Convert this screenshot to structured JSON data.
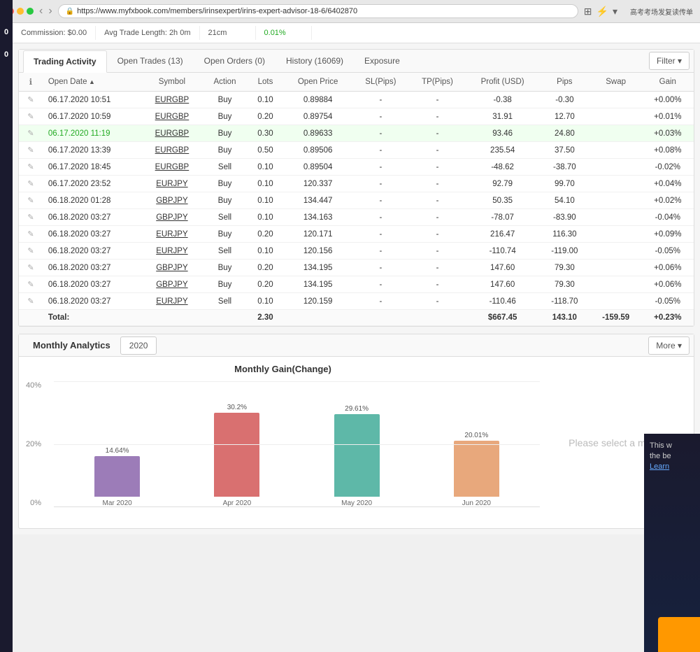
{
  "browser": {
    "url": "https://www.myfxbook.com/members/irinsexpert/irins-expert-advisor-18-6/6402870",
    "lock_symbol": "🔒"
  },
  "top_partial": {
    "cells": [
      {
        "label": "Commission:",
        "value": "$0.00"
      },
      {
        "label": "Avg Trade Length:",
        "value": "2h 0m"
      },
      {
        "label": "",
        "value": "21cm"
      },
      {
        "label": "",
        "value": "0.01%"
      }
    ]
  },
  "trading_activity": {
    "title": "Trading Activity",
    "tabs": [
      {
        "label": "Trading Activity",
        "active": true
      },
      {
        "label": "Open Trades (13)",
        "active": false
      },
      {
        "label": "Open Orders (0)",
        "active": false
      },
      {
        "label": "History (16069)",
        "active": false
      },
      {
        "label": "Exposure",
        "active": false
      }
    ],
    "filter_label": "Filter",
    "columns": [
      "",
      "Open Date",
      "Symbol",
      "Action",
      "Lots",
      "Open Price",
      "SL(Pips)",
      "TP(Pips)",
      "Profit (USD)",
      "Pips",
      "Swap",
      "Gain"
    ],
    "rows": [
      {
        "date": "06.17.2020 10:51",
        "symbol": "EURGBP",
        "action": "Buy",
        "lots": "0.10",
        "open_price": "0.89884",
        "sl": "-",
        "tp": "-",
        "profit": "-0.38",
        "pips": "-0.30",
        "swap": "",
        "gain": "+0.00%",
        "profit_class": "val-negative",
        "pips_class": "val-negative",
        "gain_class": "val-positive",
        "highlighted": false
      },
      {
        "date": "06.17.2020 10:59",
        "symbol": "EURGBP",
        "action": "Buy",
        "lots": "0.20",
        "open_price": "0.89754",
        "sl": "-",
        "tp": "-",
        "profit": "31.91",
        "pips": "12.70",
        "swap": "",
        "gain": "+0.01%",
        "profit_class": "val-positive",
        "pips_class": "val-positive",
        "gain_class": "val-positive",
        "highlighted": false
      },
      {
        "date": "06.17.2020 11:19",
        "symbol": "EURGBP",
        "action": "Buy",
        "lots": "0.30",
        "open_price": "0.89633",
        "sl": "-",
        "tp": "-",
        "profit": "93.46",
        "pips": "24.80",
        "swap": "",
        "gain": "+0.03%",
        "profit_class": "val-positive",
        "pips_class": "val-positive",
        "gain_class": "val-positive",
        "highlighted": true
      },
      {
        "date": "06.17.2020 13:39",
        "symbol": "EURGBP",
        "action": "Buy",
        "lots": "0.50",
        "open_price": "0.89506",
        "sl": "-",
        "tp": "-",
        "profit": "235.54",
        "pips": "37.50",
        "swap": "",
        "gain": "+0.08%",
        "profit_class": "val-positive",
        "pips_class": "val-positive",
        "gain_class": "val-positive",
        "highlighted": false
      },
      {
        "date": "06.17.2020 18:45",
        "symbol": "EURGBP",
        "action": "Sell",
        "lots": "0.10",
        "open_price": "0.89504",
        "sl": "-",
        "tp": "-",
        "profit": "-48.62",
        "pips": "-38.70",
        "swap": "",
        "gain": "-0.02%",
        "profit_class": "val-negative",
        "pips_class": "val-negative",
        "gain_class": "val-negative",
        "highlighted": false
      },
      {
        "date": "06.17.2020 23:52",
        "symbol": "EURJPY",
        "action": "Buy",
        "lots": "0.10",
        "open_price": "120.337",
        "sl": "-",
        "tp": "-",
        "profit": "92.79",
        "pips": "99.70",
        "swap": "",
        "gain": "+0.04%",
        "profit_class": "val-positive",
        "pips_class": "val-positive",
        "gain_class": "val-positive",
        "highlighted": false
      },
      {
        "date": "06.18.2020 01:28",
        "symbol": "GBPJPY",
        "action": "Buy",
        "lots": "0.10",
        "open_price": "134.447",
        "sl": "-",
        "tp": "-",
        "profit": "50.35",
        "pips": "54.10",
        "swap": "",
        "gain": "+0.02%",
        "profit_class": "val-positive",
        "pips_class": "val-positive",
        "gain_class": "val-positive",
        "highlighted": false
      },
      {
        "date": "06.18.2020 03:27",
        "symbol": "GBPJPY",
        "action": "Sell",
        "lots": "0.10",
        "open_price": "134.163",
        "sl": "-",
        "tp": "-",
        "profit": "-78.07",
        "pips": "-83.90",
        "swap": "",
        "gain": "-0.04%",
        "profit_class": "val-negative",
        "pips_class": "val-negative",
        "gain_class": "val-negative",
        "highlighted": false
      },
      {
        "date": "06.18.2020 03:27",
        "symbol": "EURJPY",
        "action": "Buy",
        "lots": "0.20",
        "open_price": "120.171",
        "sl": "-",
        "tp": "-",
        "profit": "216.47",
        "pips": "116.30",
        "swap": "",
        "gain": "+0.09%",
        "profit_class": "val-positive",
        "pips_class": "val-positive",
        "gain_class": "val-positive",
        "highlighted": false
      },
      {
        "date": "06.18.2020 03:27",
        "symbol": "EURJPY",
        "action": "Sell",
        "lots": "0.10",
        "open_price": "120.156",
        "sl": "-",
        "tp": "-",
        "profit": "-110.74",
        "pips": "-119.00",
        "swap": "",
        "gain": "-0.05%",
        "profit_class": "val-negative",
        "pips_class": "val-negative",
        "gain_class": "val-negative",
        "highlighted": false
      },
      {
        "date": "06.18.2020 03:27",
        "symbol": "GBPJPY",
        "action": "Buy",
        "lots": "0.20",
        "open_price": "134.195",
        "sl": "-",
        "tp": "-",
        "profit": "147.60",
        "pips": "79.30",
        "swap": "",
        "gain": "+0.06%",
        "profit_class": "val-positive",
        "pips_class": "val-positive",
        "gain_class": "val-positive",
        "highlighted": false
      },
      {
        "date": "06.18.2020 03:27",
        "symbol": "GBPJPY",
        "action": "Buy",
        "lots": "0.20",
        "open_price": "134.195",
        "sl": "-",
        "tp": "-",
        "profit": "147.60",
        "pips": "79.30",
        "swap": "",
        "gain": "+0.06%",
        "profit_class": "val-positive",
        "pips_class": "val-positive",
        "gain_class": "val-positive",
        "highlighted": false
      },
      {
        "date": "06.18.2020 03:27",
        "symbol": "EURJPY",
        "action": "Sell",
        "lots": "0.10",
        "open_price": "120.159",
        "sl": "-",
        "tp": "-",
        "profit": "-110.46",
        "pips": "-118.70",
        "swap": "",
        "gain": "-0.05%",
        "profit_class": "val-negative",
        "pips_class": "val-negative",
        "gain_class": "val-negative",
        "highlighted": false
      }
    ],
    "total": {
      "label": "Total:",
      "lots": "2.30",
      "profit": "$667.45",
      "pips": "143.10",
      "swap": "-159.59",
      "gain": "+0.23%"
    }
  },
  "monthly_analytics": {
    "title": "Monthly Analytics",
    "year": "2020",
    "more_label": "More",
    "chart_title": "Monthly Gain(Change)",
    "please_select": "Please select a month",
    "y_labels": [
      "40%",
      "20%",
      "0%"
    ],
    "bars": [
      {
        "month": "Mar 2020",
        "value": 14.64,
        "label": "14.64%",
        "color": "#9c7cb8",
        "height_pct": 36
      },
      {
        "month": "Apr 2020",
        "value": 30.2,
        "label": "30.2%",
        "color": "#d97070",
        "height_pct": 75
      },
      {
        "month": "May 2020",
        "value": 29.61,
        "label": "29.61%",
        "color": "#5eb8a8",
        "height_pct": 74
      },
      {
        "month": "Jun 2020",
        "value": 20.01,
        "label": "20.01%",
        "color": "#e8a87c",
        "height_pct": 50
      }
    ]
  },
  "right_panel": {
    "text": "This w the be",
    "link": "Learn"
  }
}
